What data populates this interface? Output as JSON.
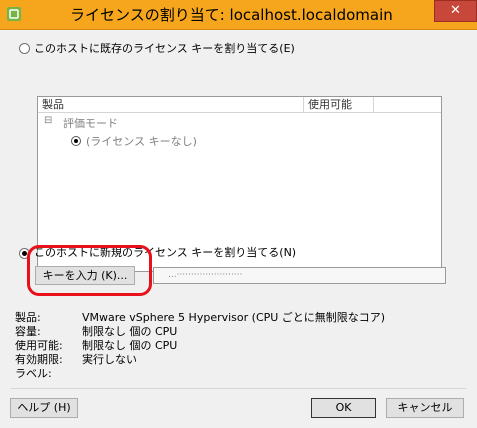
{
  "window": {
    "title": "ライセンスの割り当て: localhost.localdomain",
    "close_glyph": "✕"
  },
  "existing_option": {
    "label": "このホストに既存のライセンス キーを割り当てる(E)",
    "selected": false
  },
  "license_list": {
    "columns": [
      "製品",
      "使用可能"
    ],
    "group": {
      "toggle": "⊟",
      "label": "評価モード",
      "items": [
        "(ライセンス キーなし)"
      ]
    }
  },
  "new_option": {
    "label": "このホストに新規のライセンス キーを割り当てる(N)",
    "selected": true
  },
  "enter_key_button": {
    "label": "キーを入力 (K)..."
  },
  "key_field": {
    "value": "...·······················"
  },
  "details": [
    {
      "label": "製品:",
      "value": "VMware vSphere 5 Hypervisor (CPU ごとに無制限なコア)"
    },
    {
      "label": "容量:",
      "value": "制限なし 個の CPU"
    },
    {
      "label": "使用可能:",
      "value": "制限なし 個の CPU"
    },
    {
      "label": "有効期限:",
      "value": "実行しない"
    },
    {
      "label": "ラベル:",
      "value": ""
    }
  ],
  "footer": {
    "help_label": "ヘルプ (H)",
    "ok_label": "OK",
    "cancel_label": "キャンセル"
  },
  "colors": {
    "titlebar": "#f6a61c",
    "close_button": "#c7473a",
    "highlight": "#e8101a",
    "vmware_green": "#74b544"
  }
}
